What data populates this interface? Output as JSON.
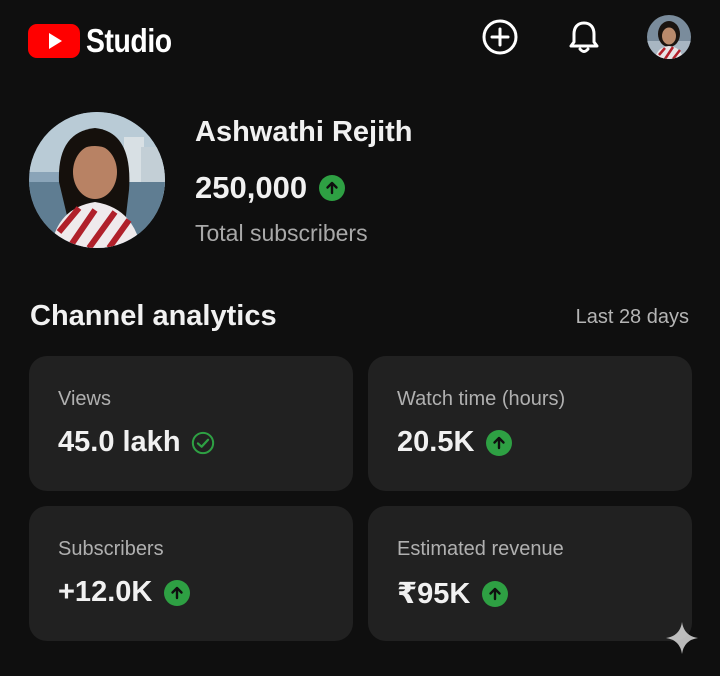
{
  "header": {
    "logo_text": "Studio",
    "create_icon": "plus-circle-icon",
    "notifications_icon": "bell-icon",
    "accent_color": "#ff0000"
  },
  "profile": {
    "name": "Ashwathi Rejith",
    "subscriber_count": "250,000",
    "subscriber_label": "Total subscribers",
    "trend_icon": "arrow-up-icon"
  },
  "analytics": {
    "title": "Channel analytics",
    "period": "Last 28 days",
    "cards": [
      {
        "label": "Views",
        "value": "45.0 lakh",
        "icon": "check-circle-icon"
      },
      {
        "label": "Watch time (hours)",
        "value": "20.5K",
        "icon": "arrow-up-icon"
      },
      {
        "label": "Subscribers",
        "value": "+12.0K",
        "icon": "arrow-up-icon"
      },
      {
        "label": "Estimated revenue",
        "value": "₹95K",
        "icon": "arrow-up-icon"
      }
    ],
    "positive_color": "#2ea043"
  }
}
